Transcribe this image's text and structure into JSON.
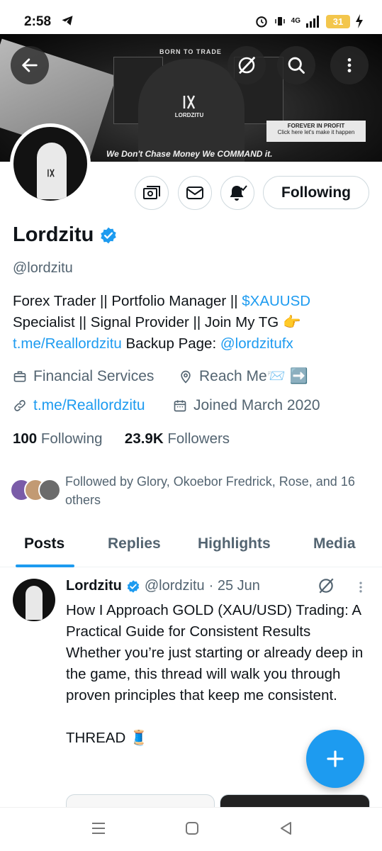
{
  "status_bar": {
    "time": "2:58",
    "network": "4G",
    "battery": "31"
  },
  "banner": {
    "headline": "BORN TO TRADE",
    "logo_text": "LORDZITU",
    "tagline": "We Don't Chase Money We COMMAND it.",
    "promo_title": "FOREVER IN PROFIT",
    "promo_sub": "Click here let's make it happen"
  },
  "actions": {
    "follow_label": "Following"
  },
  "profile": {
    "name": "Lordzitu",
    "handle": "@lordzitu",
    "bio": {
      "line1_a": "Forex Trader || Portfolio Manager || ",
      "line1_link": "$XAUUSD",
      "line2": "Specialist || Signal Provider || Join My TG 👉",
      "line3_link": "t.me/Reallordzitu",
      "line3_b": " Backup Page: ",
      "line3_link2": "@lordzitufx"
    },
    "category": "Financial Services",
    "location": "Reach Me📨 ➡️",
    "website": "t.me/Reallordzitu",
    "joined": "Joined March 2020",
    "following_count": "100",
    "following_label": " Following",
    "followers_count": "23.9K",
    "followers_label": " Followers",
    "followed_by": "Followed by Glory, Okoebor Fredrick, Rose, and 16 others"
  },
  "tabs": [
    {
      "label": "Posts"
    },
    {
      "label": "Replies"
    },
    {
      "label": "Highlights"
    },
    {
      "label": "Media"
    }
  ],
  "post": {
    "author": "Lordzitu",
    "handle": "@lordzitu",
    "date": "· 25 Jun",
    "text": "How I Approach GOLD (XAU/USD) Trading: A Practical Guide for Consistent Results\nWhether you’re just starting or already deep in the game, this thread will walk you through proven principles that keep me consistent.\n\nTHREAD 🧵"
  },
  "colors": {
    "accent": "#1d9bf0",
    "text": "#0f1419",
    "muted": "#536471"
  }
}
